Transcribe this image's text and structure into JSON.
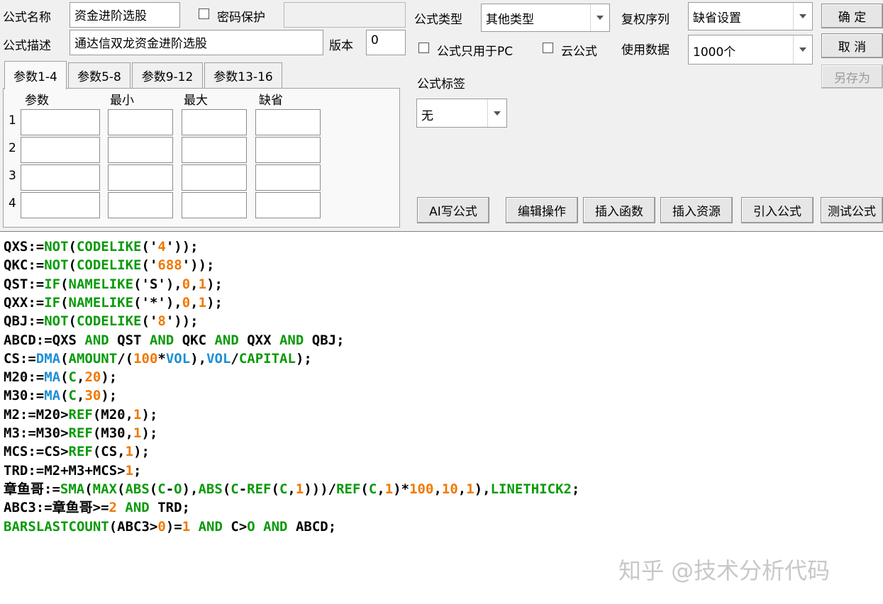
{
  "form": {
    "name_label": "公式名称",
    "name_value": "资金进阶选股",
    "password_label": "密码保护",
    "desc_label": "公式描述",
    "desc_value": "通达信双龙资金进阶选股",
    "version_label": "版本",
    "version_value": "0",
    "type_label": "公式类型",
    "type_value": "其他类型",
    "fuquan_label": "复权序列",
    "fuquan_value": "缺省设置",
    "pc_only_label": "公式只用于PC",
    "cloud_label": "云公式",
    "data_label": "使用数据",
    "data_value": "1000个",
    "tag_label": "公式标签",
    "tag_value": "无"
  },
  "buttons": {
    "ok": "确  定",
    "cancel": "取  消",
    "save_as": "另存为",
    "ai": "AI写公式",
    "edit": "编辑操作",
    "insert_func": "插入函数",
    "insert_res": "插入资源",
    "import": "引入公式",
    "test": "测试公式"
  },
  "tabs": [
    "参数1-4",
    "参数5-8",
    "参数9-12",
    "参数13-16"
  ],
  "params": {
    "headers": [
      "参数",
      "最小",
      "最大",
      "缺省"
    ],
    "rows": [
      "1",
      "2",
      "3",
      "4"
    ]
  },
  "colors": {
    "black": "#000000",
    "green": "#0a9a0a",
    "orange": "#f07800",
    "blue": "#1e8fd4"
  },
  "code_lines": [
    [
      [
        "QXS:=",
        "black"
      ],
      [
        "NOT",
        "green"
      ],
      [
        "(",
        "black"
      ],
      [
        "CODELIKE",
        "green"
      ],
      [
        "('",
        "black"
      ],
      [
        "4",
        "orange"
      ],
      [
        "'));",
        "black"
      ]
    ],
    [
      [
        "QKC:=",
        "black"
      ],
      [
        "NOT",
        "green"
      ],
      [
        "(",
        "black"
      ],
      [
        "CODELIKE",
        "green"
      ],
      [
        "('",
        "black"
      ],
      [
        "688",
        "orange"
      ],
      [
        "'));",
        "black"
      ]
    ],
    [
      [
        "QST:=",
        "black"
      ],
      [
        "IF",
        "green"
      ],
      [
        "(",
        "black"
      ],
      [
        "NAMELIKE",
        "green"
      ],
      [
        "('S'),",
        "black"
      ],
      [
        "0",
        "orange"
      ],
      [
        ",",
        "black"
      ],
      [
        "1",
        "orange"
      ],
      [
        ");",
        "black"
      ]
    ],
    [
      [
        "QXX:=",
        "black"
      ],
      [
        "IF",
        "green"
      ],
      [
        "(",
        "black"
      ],
      [
        "NAMELIKE",
        "green"
      ],
      [
        "('*'),",
        "black"
      ],
      [
        "0",
        "orange"
      ],
      [
        ",",
        "black"
      ],
      [
        "1",
        "orange"
      ],
      [
        ");",
        "black"
      ]
    ],
    [
      [
        "QBJ:=",
        "black"
      ],
      [
        "NOT",
        "green"
      ],
      [
        "(",
        "black"
      ],
      [
        "CODELIKE",
        "green"
      ],
      [
        "('",
        "black"
      ],
      [
        "8",
        "orange"
      ],
      [
        "'));",
        "black"
      ]
    ],
    [
      [
        "ABCD:=QXS ",
        "black"
      ],
      [
        "AND",
        "green"
      ],
      [
        " QST ",
        "black"
      ],
      [
        "AND",
        "green"
      ],
      [
        " QKC ",
        "black"
      ],
      [
        "AND",
        "green"
      ],
      [
        " QXX ",
        "black"
      ],
      [
        "AND",
        "green"
      ],
      [
        " QBJ;",
        "black"
      ]
    ],
    [
      [
        "CS:=",
        "black"
      ],
      [
        "DMA",
        "blue"
      ],
      [
        "(",
        "black"
      ],
      [
        "AMOUNT",
        "green"
      ],
      [
        "/(",
        "black"
      ],
      [
        "100",
        "orange"
      ],
      [
        "*",
        "black"
      ],
      [
        "VOL",
        "blue"
      ],
      [
        "),",
        "black"
      ],
      [
        "VOL",
        "blue"
      ],
      [
        "/",
        "black"
      ],
      [
        "CAPITAL",
        "green"
      ],
      [
        ");",
        "black"
      ]
    ],
    [
      [
        "M20:=",
        "black"
      ],
      [
        "MA",
        "blue"
      ],
      [
        "(",
        "black"
      ],
      [
        "C",
        "green"
      ],
      [
        ",",
        "black"
      ],
      [
        "20",
        "orange"
      ],
      [
        ");",
        "black"
      ]
    ],
    [
      [
        "M30:=",
        "black"
      ],
      [
        "MA",
        "blue"
      ],
      [
        "(",
        "black"
      ],
      [
        "C",
        "green"
      ],
      [
        ",",
        "black"
      ],
      [
        "30",
        "orange"
      ],
      [
        ");",
        "black"
      ]
    ],
    [
      [
        "M2:=M20>",
        "black"
      ],
      [
        "REF",
        "green"
      ],
      [
        "(M20,",
        "black"
      ],
      [
        "1",
        "orange"
      ],
      [
        ");",
        "black"
      ]
    ],
    [
      [
        "M3:=M30>",
        "black"
      ],
      [
        "REF",
        "green"
      ],
      [
        "(M30,",
        "black"
      ],
      [
        "1",
        "orange"
      ],
      [
        ");",
        "black"
      ]
    ],
    [
      [
        "MCS:=CS>",
        "black"
      ],
      [
        "REF",
        "green"
      ],
      [
        "(CS,",
        "black"
      ],
      [
        "1",
        "orange"
      ],
      [
        ");",
        "black"
      ]
    ],
    [
      [
        "TRD:=M2+M3+MCS>",
        "black"
      ],
      [
        "1",
        "orange"
      ],
      [
        ";",
        "black"
      ]
    ],
    [
      [
        "章鱼哥:=",
        "black"
      ],
      [
        "SMA",
        "green"
      ],
      [
        "(",
        "black"
      ],
      [
        "MAX",
        "green"
      ],
      [
        "(",
        "black"
      ],
      [
        "ABS",
        "green"
      ],
      [
        "(",
        "black"
      ],
      [
        "C",
        "green"
      ],
      [
        "-",
        "black"
      ],
      [
        "O",
        "green"
      ],
      [
        "),",
        "black"
      ],
      [
        "ABS",
        "green"
      ],
      [
        "(",
        "black"
      ],
      [
        "C",
        "green"
      ],
      [
        "-",
        "black"
      ],
      [
        "REF",
        "green"
      ],
      [
        "(",
        "black"
      ],
      [
        "C",
        "green"
      ],
      [
        ",",
        "black"
      ],
      [
        "1",
        "orange"
      ],
      [
        ")))/",
        "black"
      ],
      [
        "REF",
        "green"
      ],
      [
        "(",
        "black"
      ],
      [
        "C",
        "green"
      ],
      [
        ",",
        "black"
      ],
      [
        "1",
        "orange"
      ],
      [
        ")*",
        "black"
      ],
      [
        "100",
        "orange"
      ],
      [
        ",",
        "black"
      ],
      [
        "10",
        "orange"
      ],
      [
        ",",
        "black"
      ],
      [
        "1",
        "orange"
      ],
      [
        "),",
        "black"
      ],
      [
        "LINETHICK2",
        "green"
      ],
      [
        ";",
        "black"
      ]
    ],
    [
      [
        "ABC3:=章鱼哥>=",
        "black"
      ],
      [
        "2",
        "orange"
      ],
      [
        " ",
        "black"
      ],
      [
        "AND",
        "green"
      ],
      [
        " TRD;",
        "black"
      ]
    ],
    [
      [
        "BARSLASTCOUNT",
        "green"
      ],
      [
        "(ABC3>",
        "black"
      ],
      [
        "0",
        "orange"
      ],
      [
        ")=",
        "black"
      ],
      [
        "1",
        "orange"
      ],
      [
        " ",
        "black"
      ],
      [
        "AND",
        "green"
      ],
      [
        " C>",
        "black"
      ],
      [
        "O",
        "green"
      ],
      [
        " ",
        "black"
      ],
      [
        "AND",
        "green"
      ],
      [
        " ABCD;",
        "black"
      ]
    ]
  ],
  "watermark": "知乎 @技术分析代码"
}
